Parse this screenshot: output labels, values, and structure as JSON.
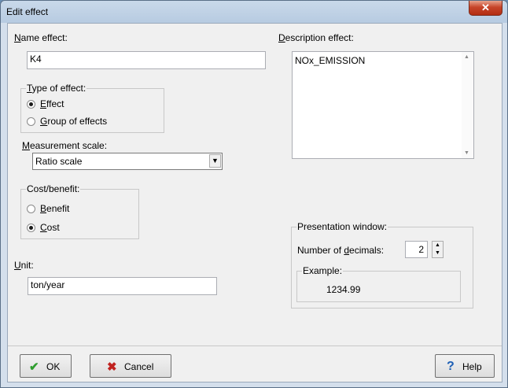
{
  "window": {
    "title": "Edit effect",
    "close_glyph": "✕"
  },
  "name_effect": {
    "label_u": "N",
    "label_rest": "ame effect:",
    "value": "K4"
  },
  "description_effect": {
    "label_u": "D",
    "label_rest": "escription effect:",
    "value": "NOx_EMISSION"
  },
  "type_of_effect": {
    "legend_u": "T",
    "legend_rest": "ype of  effect:",
    "options": [
      {
        "u": "E",
        "rest": "ffect",
        "selected": true
      },
      {
        "u": "G",
        "rest": "roup of effects",
        "selected": false
      }
    ]
  },
  "measurement_scale": {
    "label_u": "M",
    "label_rest": "easurement scale:",
    "selected": "Ratio scale"
  },
  "cost_benefit": {
    "legend": "Cost/benefit:",
    "options": [
      {
        "u": "B",
        "rest": "enefit",
        "selected": false
      },
      {
        "u": "C",
        "rest": "ost",
        "selected": true
      }
    ]
  },
  "unit": {
    "label_u": "U",
    "label_rest": "nit:",
    "value": "ton/year"
  },
  "presentation_window": {
    "legend": "Presentation window:",
    "decimals_label_pre": "Number of ",
    "decimals_label_u": "d",
    "decimals_label_post": "ecimals:",
    "decimals_value": "2",
    "example_legend": "Example:",
    "example_value": "1234.99"
  },
  "buttons": {
    "ok": "OK",
    "cancel": "Cancel",
    "help": "Help"
  },
  "colors": {
    "ok_check": "#2e9d2e",
    "cancel_x": "#c0221f",
    "help_q": "#1d5fb5",
    "close_red": "#c7452a"
  }
}
